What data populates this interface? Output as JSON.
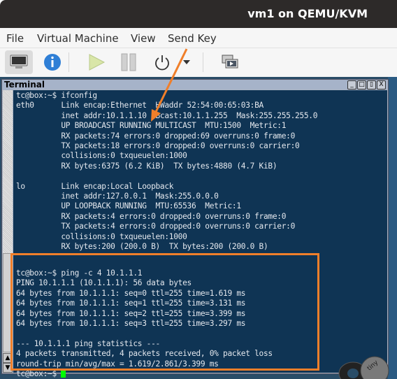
{
  "window": {
    "title": "vm1 on QEMU/KVM"
  },
  "menu": [
    "File",
    "Virtual Machine",
    "View",
    "Send Key"
  ],
  "toolbar": {
    "buttons": [
      {
        "icon": "monitor-icon",
        "label": "Show the graphical console",
        "active": true
      },
      {
        "icon": "info-icon",
        "label": "Show virtual hardware details"
      },
      {
        "icon": "play-icon",
        "label": "Run"
      },
      {
        "icon": "pause-icon",
        "label": "Pause"
      },
      {
        "icon": "power-icon",
        "label": "Shut down"
      },
      {
        "icon": "chevron-down-icon",
        "label": "Shutdown options"
      },
      {
        "icon": "snapshots-icon",
        "label": "Manage snapshots"
      }
    ]
  },
  "terminal": {
    "title": "Terminal",
    "window_buttons": [
      "_",
      "□",
      "▯",
      "X"
    ],
    "lines": [
      "tc@box:~$ ifconfig",
      "eth0      Link encap:Ethernet  HWaddr 52:54:00:65:03:BA",
      "          inet addr:10.1.1.10  Bcast:10.1.1.255  Mask:255.255.255.0",
      "          UP BROADCAST RUNNING MULTICAST  MTU:1500  Metric:1",
      "          RX packets:74 errors:0 dropped:69 overruns:0 frame:0",
      "          TX packets:18 errors:0 dropped:0 overruns:0 carrier:0",
      "          collisions:0 txqueuelen:1000",
      "          RX bytes:6375 (6.2 KiB)  TX bytes:4880 (4.7 KiB)",
      "",
      "lo        Link encap:Local Loopback",
      "          inet addr:127.0.0.1  Mask:255.0.0.0",
      "          UP LOOPBACK RUNNING  MTU:65536  Metric:1",
      "          RX packets:4 errors:0 dropped:0 overruns:0 frame:0",
      "          TX packets:4 errors:0 dropped:0 overruns:0 carrier:0",
      "          collisions:0 txqueuelen:1000",
      "          RX bytes:200 (200.0 B)  TX bytes:200 (200.0 B)",
      "",
      "tc@box:~$ ping -c 4 10.1.1.1",
      "PING 10.1.1.1 (10.1.1.1): 56 data bytes",
      "64 bytes from 10.1.1.1: seq=0 ttl=255 time=1.619 ms",
      "64 bytes from 10.1.1.1: seq=1 ttl=255 time=3.131 ms",
      "64 bytes from 10.1.1.1: seq=2 ttl=255 time=3.399 ms",
      "64 bytes from 10.1.1.1: seq=3 ttl=255 time=3.297 ms",
      "",
      "--- 10.1.1.1 ping statistics ---",
      "4 packets transmitted, 4 packets received, 0% packet loss",
      "round-trip min/avg/max = 1.619/2.861/3.399 ms"
    ],
    "prompt": "tc@box:~$ "
  },
  "annotation": {
    "color": "#f07f2a",
    "logo_text": "tiny"
  }
}
